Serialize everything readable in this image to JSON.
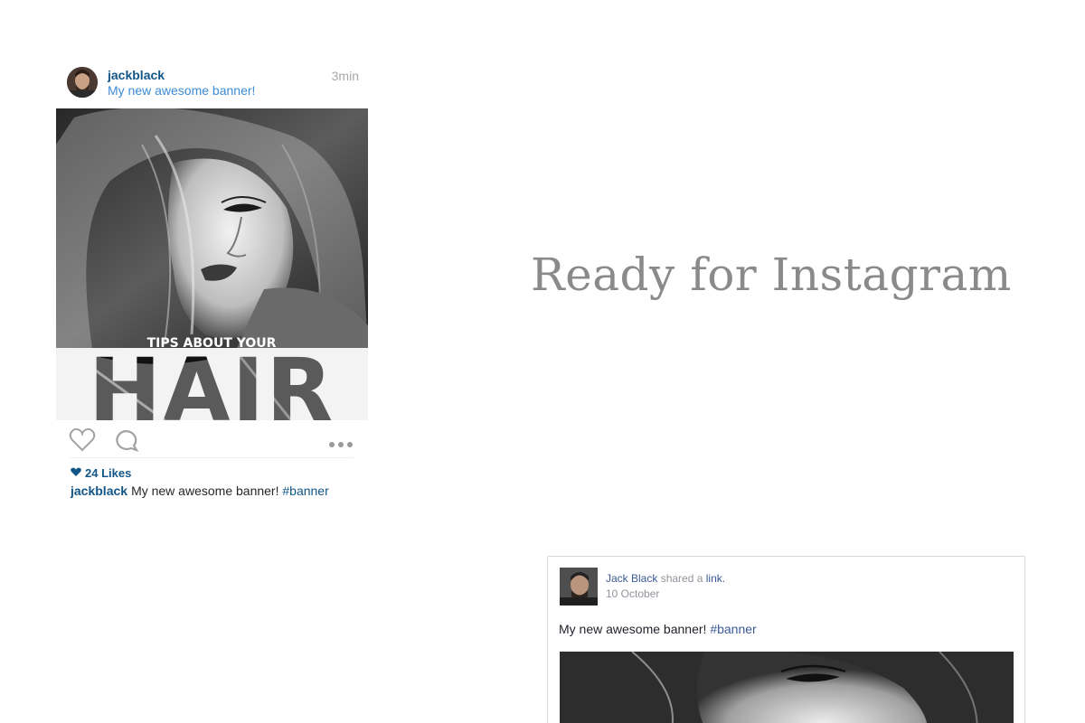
{
  "instagram": {
    "username": "jackblack",
    "caption_top": "My new awesome banner!",
    "time": "3min",
    "image": {
      "overlay_small": "TIPS ABOUT YOUR",
      "overlay_big": "HAIR"
    },
    "likes": "24 Likes",
    "caption_user": "jackblack",
    "caption_text": "My new awesome banner!",
    "caption_tag": "#banner"
  },
  "headline": "Ready for Instagram",
  "facebook": {
    "name": "Jack Black",
    "shared_text": "shared a",
    "link_text": "link.",
    "date": "10 October",
    "text": "My new awesome banner!",
    "tag": "#banner"
  },
  "colors": {
    "ig_blue": "#125688",
    "ig_link": "#3d8bd4",
    "fb_blue": "#3b5998",
    "headline_gray": "#8a8a8a"
  },
  "icons": [
    "heart-icon",
    "comment-icon",
    "more-icon",
    "small-heart-icon"
  ]
}
